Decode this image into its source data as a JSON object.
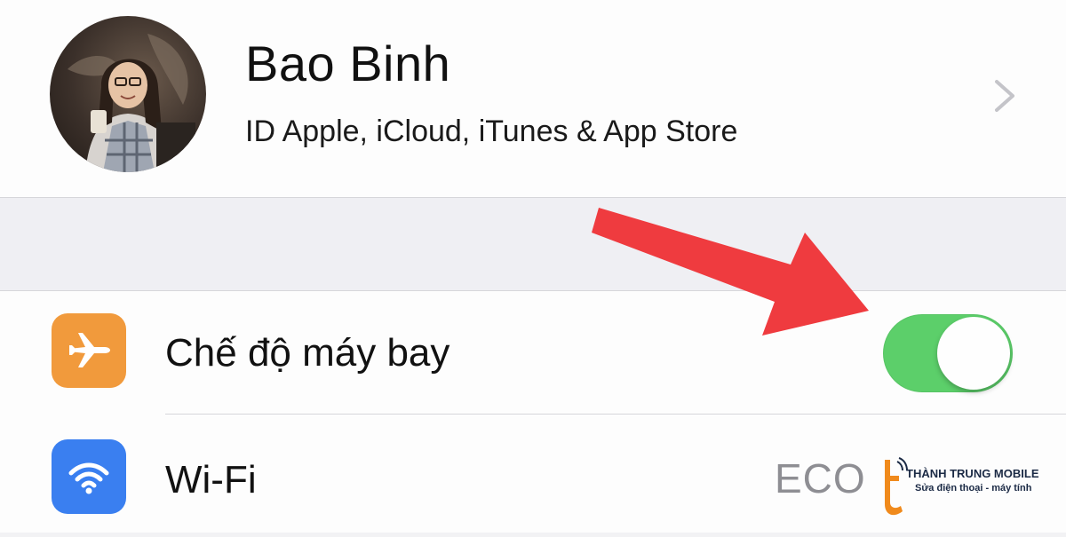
{
  "profile": {
    "name": "Bao Binh",
    "subtitle": "ID Apple, iCloud, iTunes & App Store",
    "chevron_icon": "chevron-right-icon"
  },
  "settings": [
    {
      "id": "airplane",
      "label": "Chế độ máy bay",
      "icon": "airplane-icon",
      "icon_color": "#f19a3c",
      "toggle_on": true,
      "toggle_color": "#5ccf6a"
    },
    {
      "id": "wifi",
      "label": "Wi-Fi",
      "icon": "wifi-icon",
      "icon_color": "#3a7ff0",
      "value": "ECO"
    }
  ],
  "annotation": {
    "type": "arrow",
    "color": "#ef3b3f",
    "points_to": "airplane-toggle"
  },
  "watermark": {
    "title": "THÀNH TRUNG MOBILE",
    "subtitle": "Sửa điện thoại - máy tính",
    "accent": "#f08a1c"
  }
}
